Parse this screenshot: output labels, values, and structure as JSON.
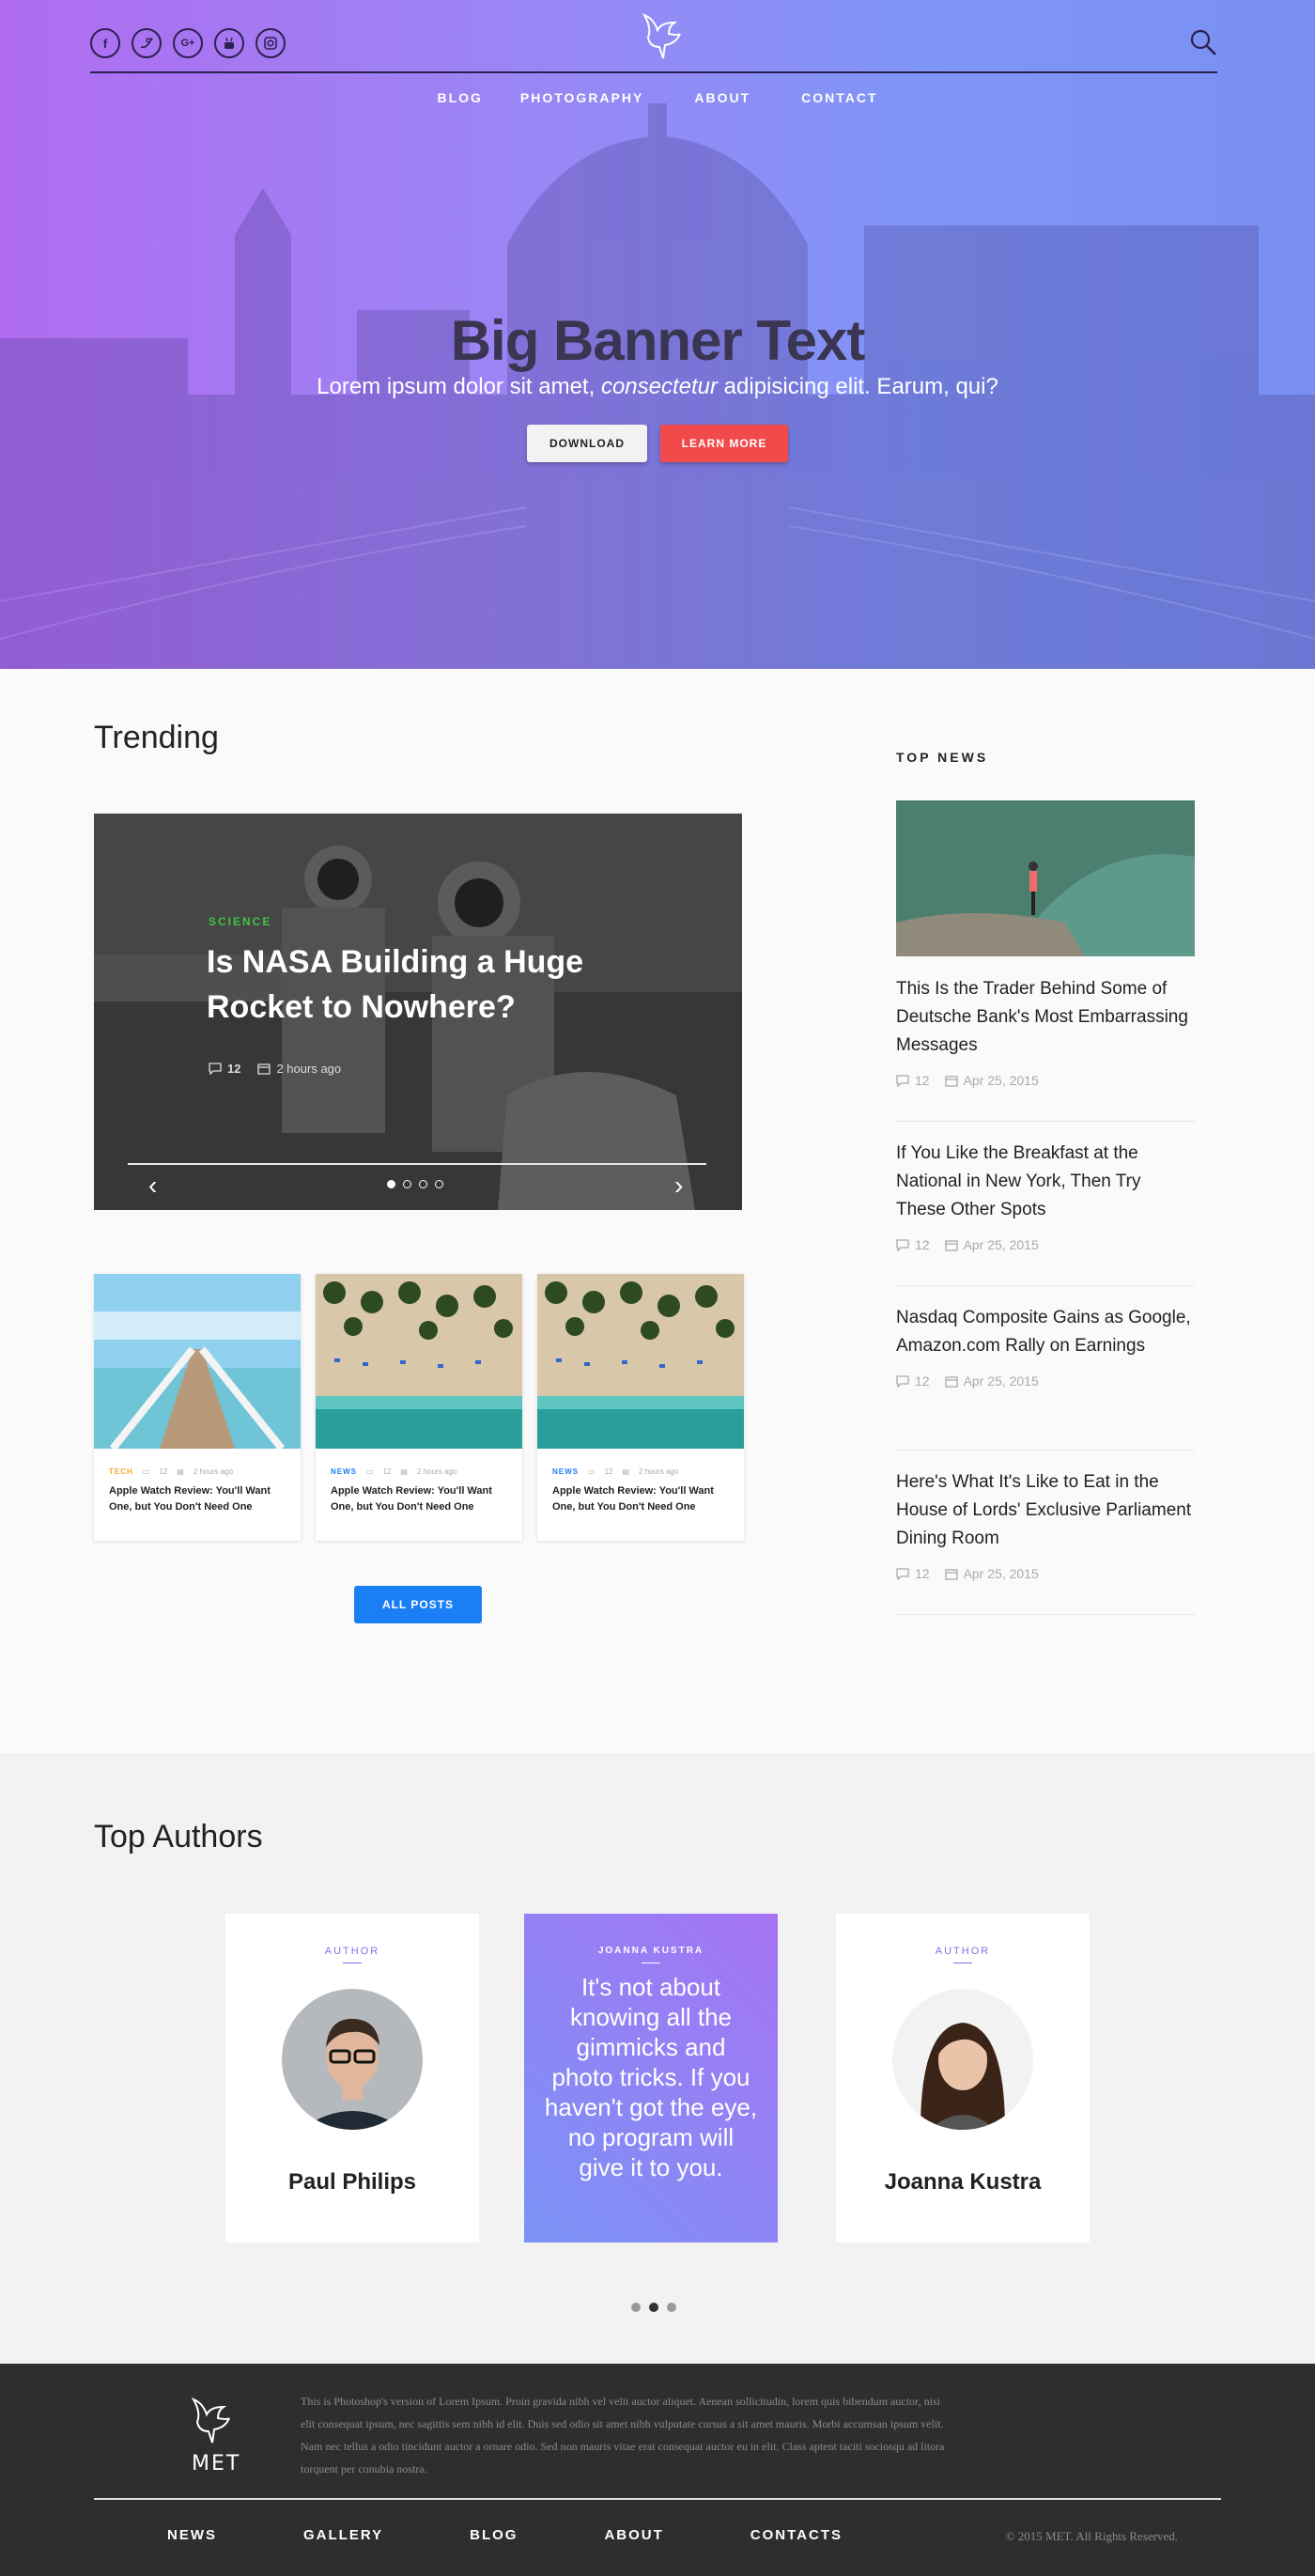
{
  "header": {
    "social": [
      "f",
      "t",
      "G+",
      "yt",
      "ig"
    ],
    "nav": [
      "BLOG",
      "PHOTOGRAPHY",
      "ABOUT",
      "CONTACT"
    ]
  },
  "hero": {
    "title": "Big Banner Text",
    "subtitle_start": "Lorem ipsum dolor sit amet, ",
    "subtitle_italic": "consectetur",
    "subtitle_end": " adipisicing elit. Earum, qui?",
    "download_label": "DOWNLOAD",
    "learn_label": "LEARN MORE"
  },
  "trending": {
    "title": "Trending",
    "slide": {
      "category": "SCIENCE",
      "title": "Is NASA Building a Huge Rocket to Nowhere?",
      "comments": "12",
      "time": "2 hours ago"
    },
    "cards": [
      {
        "tag": "TECH",
        "tag_color": "#f5a623",
        "comments": "12",
        "time": "2 hours ago",
        "title": "Apple Watch Review: You'll Want One, but You Don't Need One"
      },
      {
        "tag": "NEWS",
        "tag_color": "#1a7ef5",
        "comments": "12",
        "time": "2 hours ago",
        "title": "Apple Watch Review: You'll Want One, but You Don't Need One"
      },
      {
        "tag": "NEWS",
        "tag_color": "#1a7ef5",
        "comments": "12",
        "time": "2 hours ago",
        "title": "Apple Watch Review: You'll Want One, but You Don't Need One"
      }
    ],
    "all_posts_label": "ALL POSTS"
  },
  "top_news": {
    "label": "TOP NEWS",
    "items": [
      {
        "title": "This Is the Trader Behind Some of Deutsche Bank's Most Embarrassing Messages",
        "comments": "12",
        "date": "Apr 25, 2015"
      },
      {
        "title": "If You Like the Breakfast at the National in New York, Then Try These Other Spots",
        "comments": "12",
        "date": "Apr 25, 2015"
      },
      {
        "title": "Nasdaq Composite Gains as Google, Amazon.com Rally on Earnings",
        "comments": "12",
        "date": "Apr 25, 2015"
      },
      {
        "title": "Here's What It's Like to Eat in the House of Lords' Exclusive Parliament Dining Room",
        "comments": "12",
        "date": "Apr 25, 2015"
      }
    ]
  },
  "authors": {
    "title": "Top Authors",
    "left": {
      "label": "AUTHOR",
      "name": "Paul Philips"
    },
    "quote": {
      "label": "JOANNA KUSTRA",
      "text": "It's not about knowing all the gimmicks and photo tricks. If you haven't got the eye, no program will give it to you."
    },
    "right": {
      "label": "AUTHOR",
      "name": "Joanna Kustra"
    }
  },
  "footer": {
    "brand": "MET",
    "text": "This is Photoshop's version  of Lorem Ipsum. Proin gravida nibh vel velit auctor aliquet. Aenean sollicitudin, lorem quis bibendum auctor, nisi elit consequat ipsum, nec sagittis sem nibh id elit. Duis sed odio sit amet nibh vulputate cursus a sit amet mauris. Morbi accumsan ipsum velit. Nam nec tellus a odio tincidunt auctor a ornare odio. Sed non  mauris vitae erat consequat auctor eu in elit. Class aptent taciti sociosqu ad litora torquent per conubia nostra.",
    "nav": [
      "NEWS",
      "GALLERY",
      "BLOG",
      "ABOUT",
      "CONTACTS"
    ],
    "copyright": "© 2015  MET. All Rights Reserved."
  },
  "colors": {
    "accent_blue": "#1a7ef5",
    "accent_red": "#f24a4a",
    "science_green": "#3fc441",
    "author_purple": "#7a74e8"
  }
}
